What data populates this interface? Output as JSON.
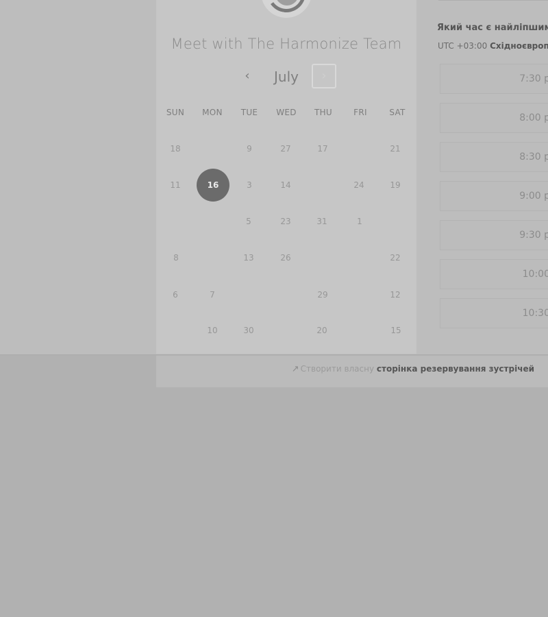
{
  "calendar": {
    "title": "Meet with The Harmonize Team",
    "month": "July",
    "prev_icon": "‹",
    "next_icon": "›",
    "weekdays": [
      "SUN",
      "MON",
      "TUE",
      "WED",
      "THU",
      "FRI",
      "SAT"
    ],
    "selected_day": "16",
    "days": {
      "r0c0": "18",
      "r0c2": "9",
      "r0c3": "27",
      "r0c4": "17",
      "r0c6": "21",
      "r1c0": "11",
      "r1c1": "16",
      "r1c2": "3",
      "r1c3": "14",
      "r1c5": "24",
      "r1c6": "19",
      "r2c2": "5",
      "r2c3": "23",
      "r2c4": "31",
      "r2c5": "1",
      "r3c0": "8",
      "r3c2": "13",
      "r3c3": "26",
      "r3c6": "22",
      "r4c0": "6",
      "r4c1": "7",
      "r4c4": "29",
      "r4c6": "12",
      "r5c1": "10",
      "r5c2": "30",
      "r5c4": "20",
      "r5c6": "15"
    }
  },
  "times": {
    "question": "Який час є найліпшим",
    "timezone_prefix": "UTC +03:00 ",
    "timezone_name": "Східноєвроп",
    "slots": [
      "7:30 p",
      "8:00 p",
      "8:30 p",
      "9:00 p",
      "9:30 p",
      "10:00",
      "10:30"
    ]
  },
  "footer": {
    "arrow_icon": "↗",
    "link_muted": "Створити власну ",
    "link_bold": "сторінка резервування зустрічей"
  }
}
